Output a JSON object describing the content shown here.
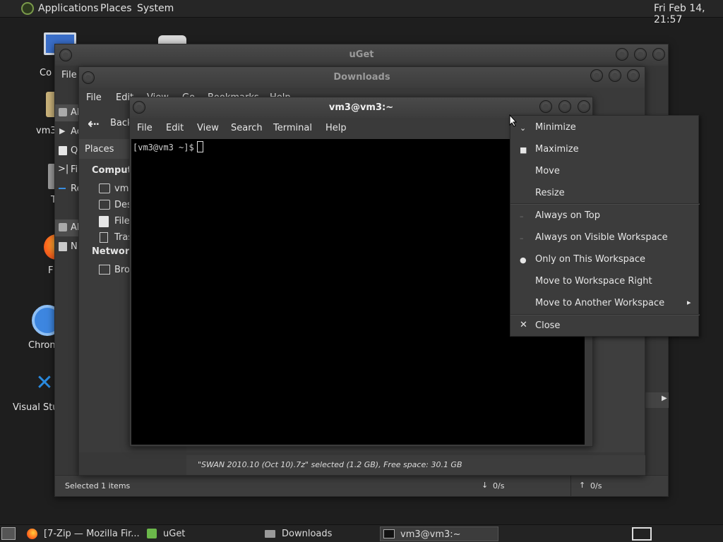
{
  "top_panel": {
    "menu": [
      "Applications",
      "Places",
      "System"
    ],
    "clock": "Fri Feb 14, 21:57"
  },
  "desktop_icons": [
    {
      "label": "Co",
      "icon": "computer-icon"
    },
    {
      "label": "vm3",
      "icon": "home-folder-icon"
    },
    {
      "label": "T",
      "icon": "trash-icon"
    },
    {
      "label": "F",
      "icon": "firefox-icon"
    },
    {
      "label": "Chron",
      "icon": "chromium-icon"
    },
    {
      "label": "Visual Stu",
      "icon": "vscode-icon"
    }
  ],
  "uget": {
    "title": "uGet",
    "menu_file": "File",
    "sidebar": [
      "Al",
      "Ac",
      "Q",
      "Fi",
      "Re",
      "Al",
      "N"
    ],
    "status": "Selected 1 items",
    "down_rate": "0/s",
    "up_rate": "0/s"
  },
  "downloads": {
    "title": "Downloads",
    "menu": [
      "File",
      "Edit",
      "View",
      "Go",
      "Bookmarks",
      "Help"
    ],
    "back_label": "Back",
    "places_label": "Places",
    "sections": [
      {
        "heading": "Computer",
        "items": [
          "vm3",
          "Desktop",
          "File System",
          "Trash"
        ]
      },
      {
        "heading": "Network",
        "items": [
          "Browse Network"
        ]
      }
    ],
    "status_text": "\"SWAN 2010.10 (Oct 10).7z\" selected (1.2 GB), Free space: 30.1 GB"
  },
  "terminal": {
    "title": "vm3@vm3:~",
    "menu": [
      "File",
      "Edit",
      "View",
      "Search",
      "Terminal",
      "Help"
    ],
    "prompt": "[vm3@vm3 ~]$"
  },
  "context_menu": {
    "items": [
      {
        "label": "Minimize",
        "mark": ""
      },
      {
        "label": "Maximize",
        "mark": "■"
      },
      {
        "label": "Move",
        "mark": ""
      },
      {
        "label": "Resize",
        "mark": ""
      },
      {
        "label": "Always on Top",
        "mark": "–"
      },
      {
        "label": "Always on Visible Workspace",
        "mark": "–"
      },
      {
        "label": "Only on This Workspace",
        "mark": "●"
      },
      {
        "label": "Move to Workspace Right",
        "mark": ""
      },
      {
        "label": "Move to Another Workspace",
        "mark": "▸"
      },
      {
        "label": "Close",
        "mark": "✕"
      }
    ]
  },
  "taskbar": {
    "tasks": [
      {
        "label": "[7-Zip — Mozilla Fir...",
        "icon": "firefox-icon"
      },
      {
        "label": "uGet",
        "icon": "uget-icon"
      },
      {
        "label": "Downloads",
        "icon": "folder-icon"
      },
      {
        "label": "vm3@vm3:~",
        "icon": "terminal-icon"
      }
    ]
  },
  "colors": {
    "panel": "#262626",
    "window": "#3a3a3a",
    "terminal_bg": "#000000",
    "text": "#e6e6e6"
  }
}
